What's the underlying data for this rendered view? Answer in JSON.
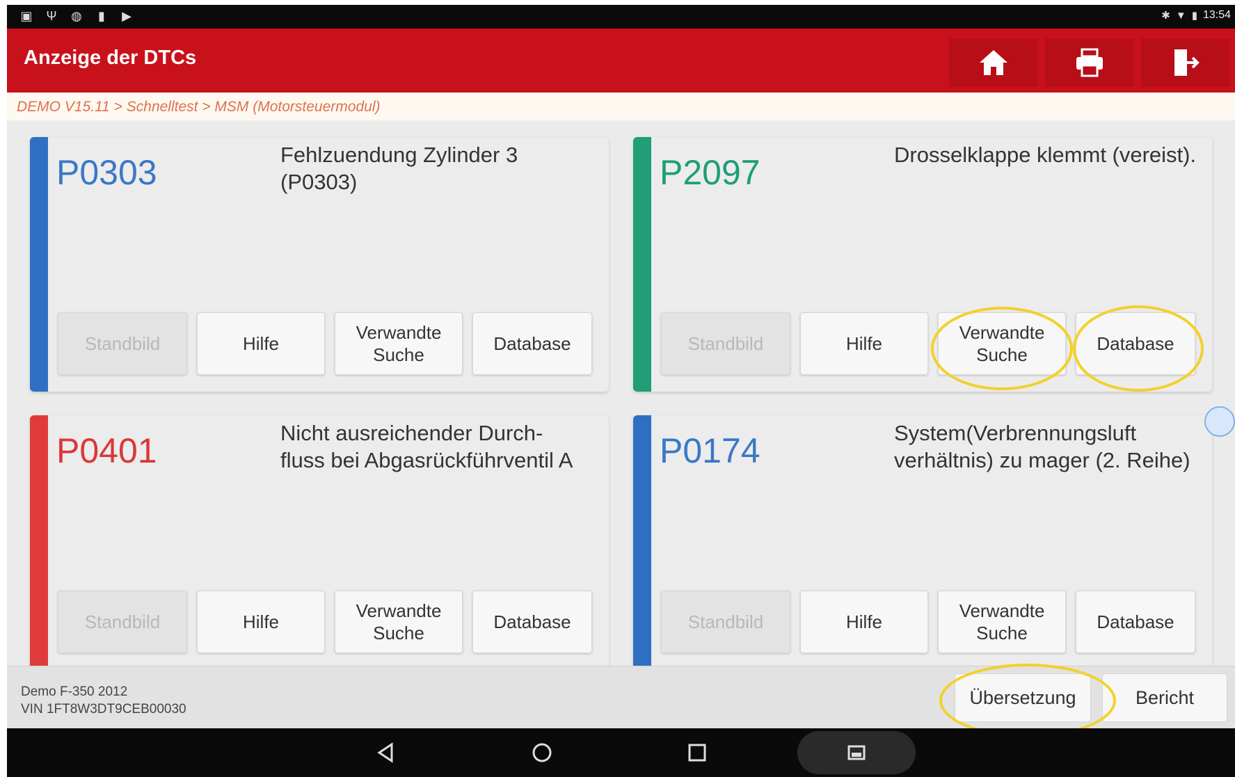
{
  "status_bar": {
    "left_icons": [
      "notification-icon",
      "signal-icon",
      "usb-icon",
      "sd-icon",
      "play-icon"
    ],
    "time": "13:54"
  },
  "app_bar": {
    "title": "Anzeige der DTCs",
    "buttons": [
      "home-icon",
      "print-icon",
      "exit-icon"
    ]
  },
  "breadcrumb": "DEMO V15.11 > Schnelltest > MSM (Motorsteuermodul)",
  "dtc_cards": [
    {
      "code": "P0303",
      "description": "Fehlzuendung Zylinder 3 (P0303)",
      "accent_color": "#2f6fc3",
      "code_color": "#3a78c8",
      "buttons": {
        "standbild": "Standbild",
        "hilfe": "Hilfe",
        "verwandte_suche": "Verwandte Suche",
        "database": "Database"
      }
    },
    {
      "code": "P2097",
      "description": "Drosselklappe klemmt (vereist).",
      "accent_color": "#1f9e78",
      "code_color": "#1f9e78",
      "buttons": {
        "standbild": "Standbild",
        "hilfe": "Hilfe",
        "verwandte_suche": "Verwandte Suche",
        "database": "Database"
      }
    },
    {
      "code": "P0401",
      "description": "Nicht ausreichender Durch-fluss bei Abgasrückführventil A",
      "accent_color": "#e03b3b",
      "code_color": "#d93838",
      "buttons": {
        "standbild": "Standbild",
        "hilfe": "Hilfe",
        "verwandte_suche": "Verwandte Suche",
        "database": "Database"
      }
    },
    {
      "code": "P0174",
      "description": "System(Verbrennungsluft verhältnis) zu mager (2. Reihe)",
      "accent_color": "#2f6fc3",
      "code_color": "#3a78c8",
      "buttons": {
        "standbild": "Standbild",
        "hilfe": "Hilfe",
        "verwandte_suche": "Verwandte Suche",
        "database": "Database"
      }
    }
  ],
  "bottom_bar": {
    "vehicle": "Demo F-350 2012",
    "vin": "VIN 1FT8W3DT9CEB00030",
    "translate_label": "Übersetzung",
    "report_label": "Bericht"
  },
  "nav_bar": [
    "back-icon",
    "home-circle-icon",
    "recents-icon",
    "screenshot-icon"
  ],
  "colors": {
    "app_bar": "#c9111c",
    "highlight": "#f2d12a"
  }
}
